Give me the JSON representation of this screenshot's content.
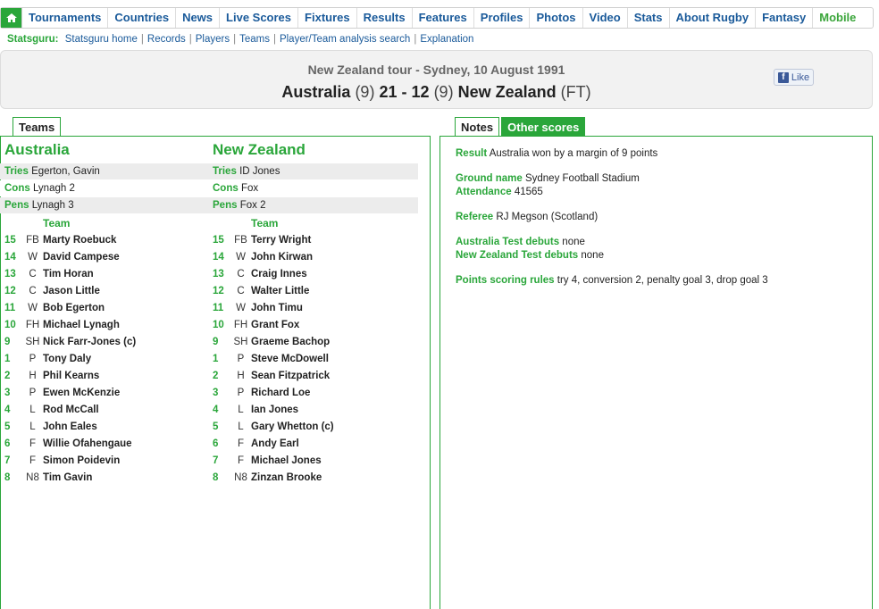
{
  "nav": {
    "items": [
      "Tournaments",
      "Countries",
      "News",
      "Live Scores",
      "Fixtures",
      "Results",
      "Features",
      "Profiles",
      "Photos",
      "Video",
      "Stats",
      "About Rugby",
      "Fantasy"
    ],
    "mobile": "Mobile"
  },
  "statsguru": {
    "label": "Statsguru:",
    "links": [
      "Statsguru home",
      "Records",
      "Players",
      "Teams",
      "Player/Team analysis search",
      "Explanation"
    ]
  },
  "match": {
    "tour": "New Zealand tour - Sydney, 10 August 1991",
    "home": "Australia",
    "home_ht": "(9)",
    "home_score": "21",
    "dash": "-",
    "away_score": "12",
    "away_ht": "(9)",
    "away": "New Zealand",
    "status": "(FT)",
    "like": "Like"
  },
  "tabs": {
    "teams": "Teams",
    "notes": "Notes",
    "other_scores": "Other scores"
  },
  "home_team": {
    "name": "Australia",
    "tries_label": "Tries",
    "tries": "Egerton, Gavin",
    "cons_label": "Cons",
    "cons": "Lynagh 2",
    "pens_label": "Pens",
    "pens": "Lynagh 3",
    "team_label": "Team",
    "players": [
      {
        "num": "15",
        "pos": "FB",
        "name": "Marty Roebuck"
      },
      {
        "num": "14",
        "pos": "W",
        "name": "David Campese"
      },
      {
        "num": "13",
        "pos": "C",
        "name": "Tim Horan"
      },
      {
        "num": "12",
        "pos": "C",
        "name": "Jason Little"
      },
      {
        "num": "11",
        "pos": "W",
        "name": "Bob Egerton"
      },
      {
        "num": "10",
        "pos": "FH",
        "name": "Michael Lynagh"
      },
      {
        "num": "9",
        "pos": "SH",
        "name": "Nick Farr-Jones (c)"
      },
      {
        "num": "1",
        "pos": "P",
        "name": "Tony Daly"
      },
      {
        "num": "2",
        "pos": "H",
        "name": "Phil Kearns"
      },
      {
        "num": "3",
        "pos": "P",
        "name": "Ewen McKenzie"
      },
      {
        "num": "4",
        "pos": "L",
        "name": "Rod McCall"
      },
      {
        "num": "5",
        "pos": "L",
        "name": "John Eales"
      },
      {
        "num": "6",
        "pos": "F",
        "name": "Willie Ofahengaue"
      },
      {
        "num": "7",
        "pos": "F",
        "name": "Simon Poidevin"
      },
      {
        "num": "8",
        "pos": "N8",
        "name": "Tim Gavin"
      }
    ]
  },
  "away_team": {
    "name": "New Zealand",
    "tries_label": "Tries",
    "tries": "ID Jones",
    "cons_label": "Cons",
    "cons": "Fox",
    "pens_label": "Pens",
    "pens": "Fox 2",
    "team_label": "Team",
    "players": [
      {
        "num": "15",
        "pos": "FB",
        "name": "Terry Wright"
      },
      {
        "num": "14",
        "pos": "W",
        "name": "John Kirwan"
      },
      {
        "num": "13",
        "pos": "C",
        "name": "Craig Innes"
      },
      {
        "num": "12",
        "pos": "C",
        "name": "Walter Little"
      },
      {
        "num": "11",
        "pos": "W",
        "name": "John Timu"
      },
      {
        "num": "10",
        "pos": "FH",
        "name": "Grant Fox"
      },
      {
        "num": "9",
        "pos": "SH",
        "name": "Graeme Bachop"
      },
      {
        "num": "1",
        "pos": "P",
        "name": "Steve McDowell"
      },
      {
        "num": "2",
        "pos": "H",
        "name": "Sean Fitzpatrick"
      },
      {
        "num": "3",
        "pos": "P",
        "name": "Richard Loe"
      },
      {
        "num": "4",
        "pos": "L",
        "name": "Ian Jones"
      },
      {
        "num": "5",
        "pos": "L",
        "name": "Gary Whetton (c)"
      },
      {
        "num": "6",
        "pos": "F",
        "name": "Andy Earl"
      },
      {
        "num": "7",
        "pos": "F",
        "name": "Michael Jones"
      },
      {
        "num": "8",
        "pos": "N8",
        "name": "Zinzan Brooke"
      }
    ]
  },
  "notes": {
    "result_label": "Result",
    "result": "Australia won by a margin of 9 points",
    "ground_label": "Ground name",
    "ground": "Sydney Football Stadium",
    "attendance_label": "Attendance",
    "attendance": "41565",
    "referee_label": "Referee",
    "referee": "RJ Megson (Scotland)",
    "aus_debuts_label": "Australia Test debuts",
    "aus_debuts": "none",
    "nz_debuts_label": "New Zealand Test debuts",
    "nz_debuts": "none",
    "points_label": "Points scoring rules",
    "points": "try 4, conversion 2, penalty goal 3, drop goal 3"
  }
}
